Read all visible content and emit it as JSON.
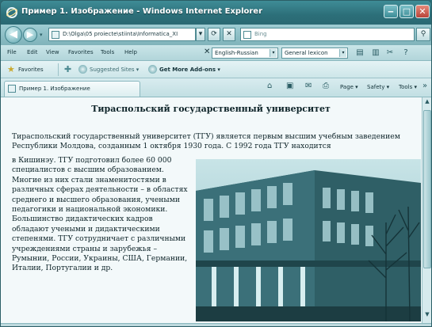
{
  "window": {
    "title": "Пример 1. Изображение - Windows Internet Explorer",
    "minimize": "‒",
    "maximize": "□",
    "close": "✕"
  },
  "address": {
    "url": "D:\\Olga\\05 proiecte\\stiinta\\Informatica_XI",
    "search_placeholder": "Bing"
  },
  "menu": {
    "items": [
      "File",
      "Edit",
      "View",
      "Favorites",
      "Tools",
      "Help"
    ]
  },
  "toolbar": {
    "dictionary": "English-Russian",
    "lexicon": "General lexicon"
  },
  "favorites": {
    "label": "Favorites",
    "suggested": "Suggested Sites ▾",
    "addons": "Get More Add-ons ▾"
  },
  "tab": {
    "label": "Пример 1. Изображение"
  },
  "commandbar": {
    "page": "Page ▾",
    "safety": "Safety ▾",
    "tools": "Tools ▾"
  },
  "page": {
    "heading": "Тираспольский государственный университет",
    "para_full": "Тираспольский государственный университет (ТГУ) является первым высшим учебным заведением Республики Молдова, созданным 1 октября 1930 года. С 1992 года ТГУ находится",
    "para_col": "в Кишинэу. ТГУ подготовил более 60 000 специалистов с высшим образованием. Многие из них стали знаменитостями в различных сферах деятельности – в областях среднего и высшего образования, учеными педагогики и национальной экономики. Большинство дидактических кадров обладают учеными и дидактическими степенями. ТГУ сотрудничает с различными учреждениями страны и зарубежья – Румынии, России, Украины, США, Германии, Италии, Португалии и др."
  }
}
